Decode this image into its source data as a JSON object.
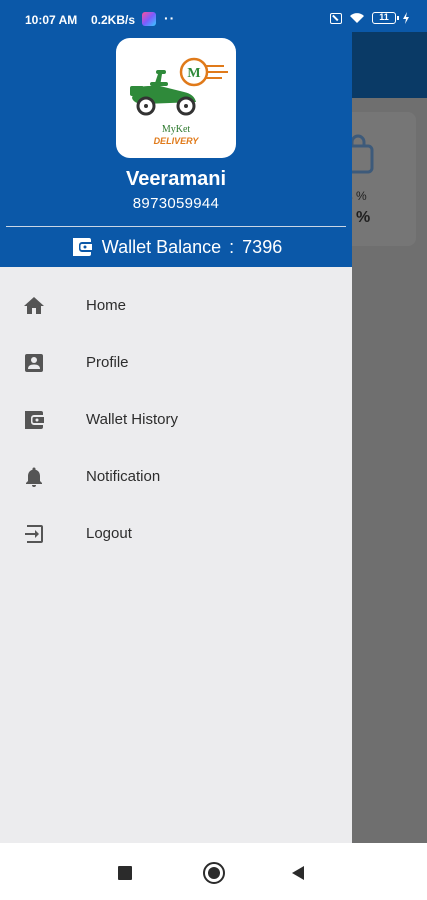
{
  "status_bar": {
    "time": "10:07 AM",
    "network_speed": "0.2KB/s",
    "dots": "··",
    "battery": "11"
  },
  "background": {
    "card_label": "us %",
    "card_value": "%"
  },
  "drawer": {
    "logo": {
      "brand_text": "MyKet",
      "brand_subtext": "DELIVERY",
      "badge_letter": "M"
    },
    "user_name": "Veeramani",
    "user_phone": "8973059944",
    "wallet_label": "Wallet Balance",
    "wallet_separator": ":",
    "wallet_amount": "7396",
    "menu_items": [
      {
        "label": "Home",
        "icon": "home-icon"
      },
      {
        "label": "Profile",
        "icon": "profile-icon"
      },
      {
        "label": "Wallet History",
        "icon": "wallet-icon"
      },
      {
        "label": "Notification",
        "icon": "bell-icon"
      },
      {
        "label": "Logout",
        "icon": "logout-icon"
      }
    ]
  },
  "colors": {
    "header_blue": "#0b58a8",
    "drawer_bg": "#ececee",
    "icon_gray": "#555555",
    "logo_green": "#2f8a3a",
    "logo_orange": "#e07a1a"
  }
}
